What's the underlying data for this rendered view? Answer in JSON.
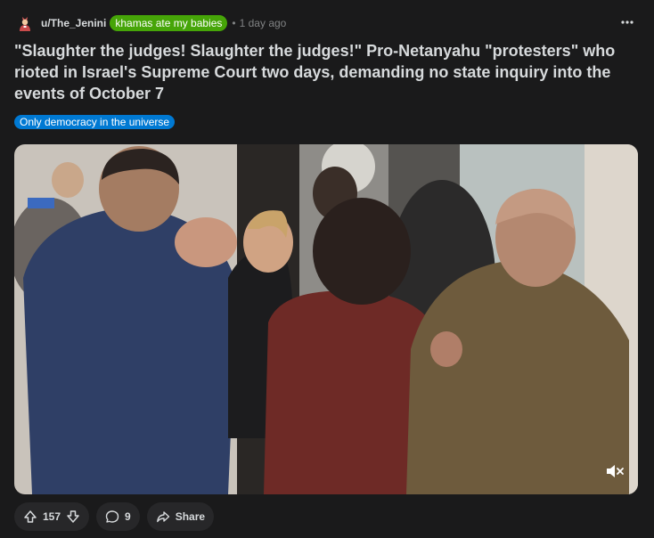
{
  "post": {
    "author": "u/The_Jenini",
    "user_flair": "khamas ate my babies",
    "separator": "•",
    "time": "1 day ago",
    "title": "\"Slaughter the judges! Slaughter the judges!\" Pro-Netanyahu \"protesters\" who rioted in Israel's Supreme Court two days, demanding no state inquiry into the events of October 7",
    "post_flair": "Only democracy in the universe"
  },
  "actions": {
    "votes": "157",
    "comments": "9",
    "share_label": "Share"
  },
  "icons": {
    "avatar": "avatar-icon",
    "more": "more-options-icon",
    "upvote": "upvote-arrow-icon",
    "downvote": "downvote-arrow-icon",
    "comment": "comment-bubble-icon",
    "share": "share-arrow-icon",
    "mute": "muted-speaker-icon"
  },
  "colors": {
    "background": "#1a1a1b",
    "user_flair": "#46a508",
    "post_flair": "#0079d3",
    "pill": "#272729"
  }
}
